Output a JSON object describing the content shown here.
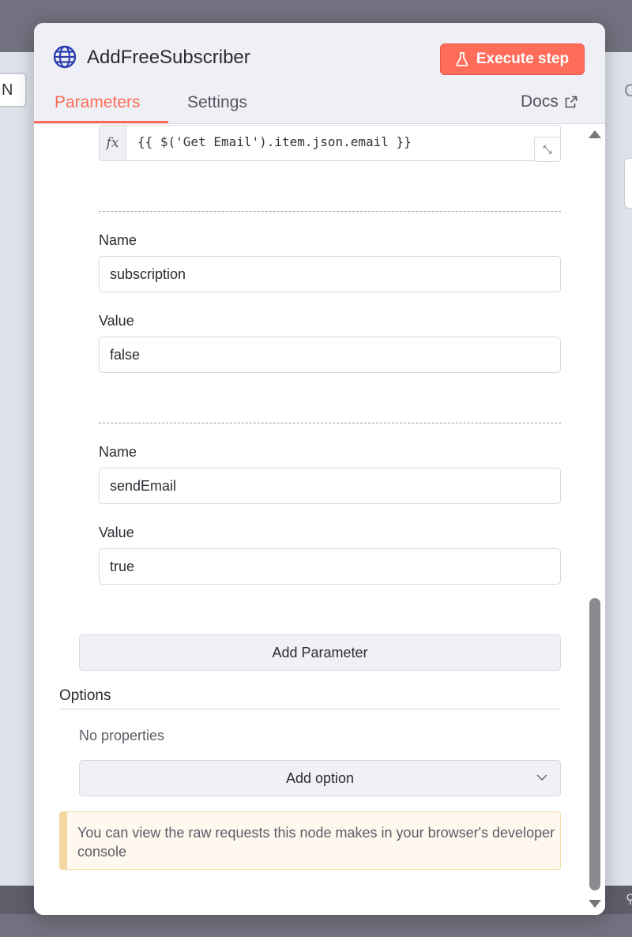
{
  "background": {
    "left_node_letter": "N",
    "right_letter": "C"
  },
  "node": {
    "title": "AddFreeSubscriber",
    "icon": "globe-icon",
    "accent_color": "#ff6d5a"
  },
  "header": {
    "execute_label": "Execute step",
    "tabs": [
      {
        "label": "Parameters",
        "active": true
      },
      {
        "label": "Settings",
        "active": false
      }
    ],
    "docs_label": "Docs"
  },
  "expression": {
    "fx_label": "fx",
    "value": "{{ $('Get Email').item.json.email }}"
  },
  "parameters": [
    {
      "name_label": "Name",
      "name": "subscription",
      "value_label": "Value",
      "value": "false"
    },
    {
      "name_label": "Name",
      "name": "sendEmail",
      "value_label": "Value",
      "value": "true"
    }
  ],
  "add_parameter_label": "Add Parameter",
  "options": {
    "label": "Options",
    "empty_text": "No properties",
    "add_option_label": "Add option"
  },
  "notice": {
    "text": "You can view the raw requests this node makes in your browser's developer console"
  }
}
